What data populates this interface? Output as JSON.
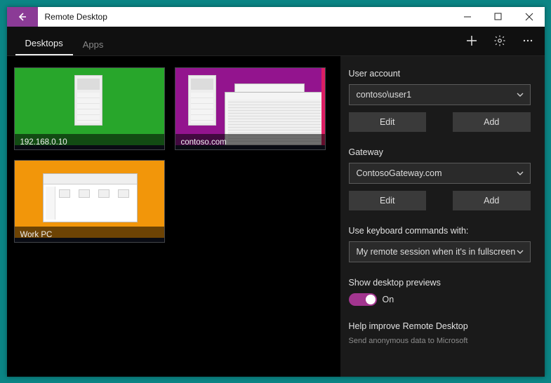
{
  "window": {
    "title": "Remote Desktop"
  },
  "tabs": {
    "desktops": "Desktops",
    "apps": "Apps"
  },
  "desktops": [
    {
      "name": "192.168.0.10"
    },
    {
      "name": "contoso.com"
    },
    {
      "name": "Work PC"
    }
  ],
  "settings": {
    "userAccount": {
      "label": "User account",
      "value": "contoso\\user1",
      "edit": "Edit",
      "add": "Add"
    },
    "gateway": {
      "label": "Gateway",
      "value": "ContosoGateway.com",
      "edit": "Edit",
      "add": "Add"
    },
    "keyboard": {
      "label": "Use keyboard commands with:",
      "value": "My remote session when it's in fullscreen"
    },
    "previews": {
      "label": "Show desktop previews",
      "state": "On"
    },
    "help": {
      "label": "Help improve Remote Desktop",
      "sub": "Send anonymous data to Microsoft"
    }
  }
}
